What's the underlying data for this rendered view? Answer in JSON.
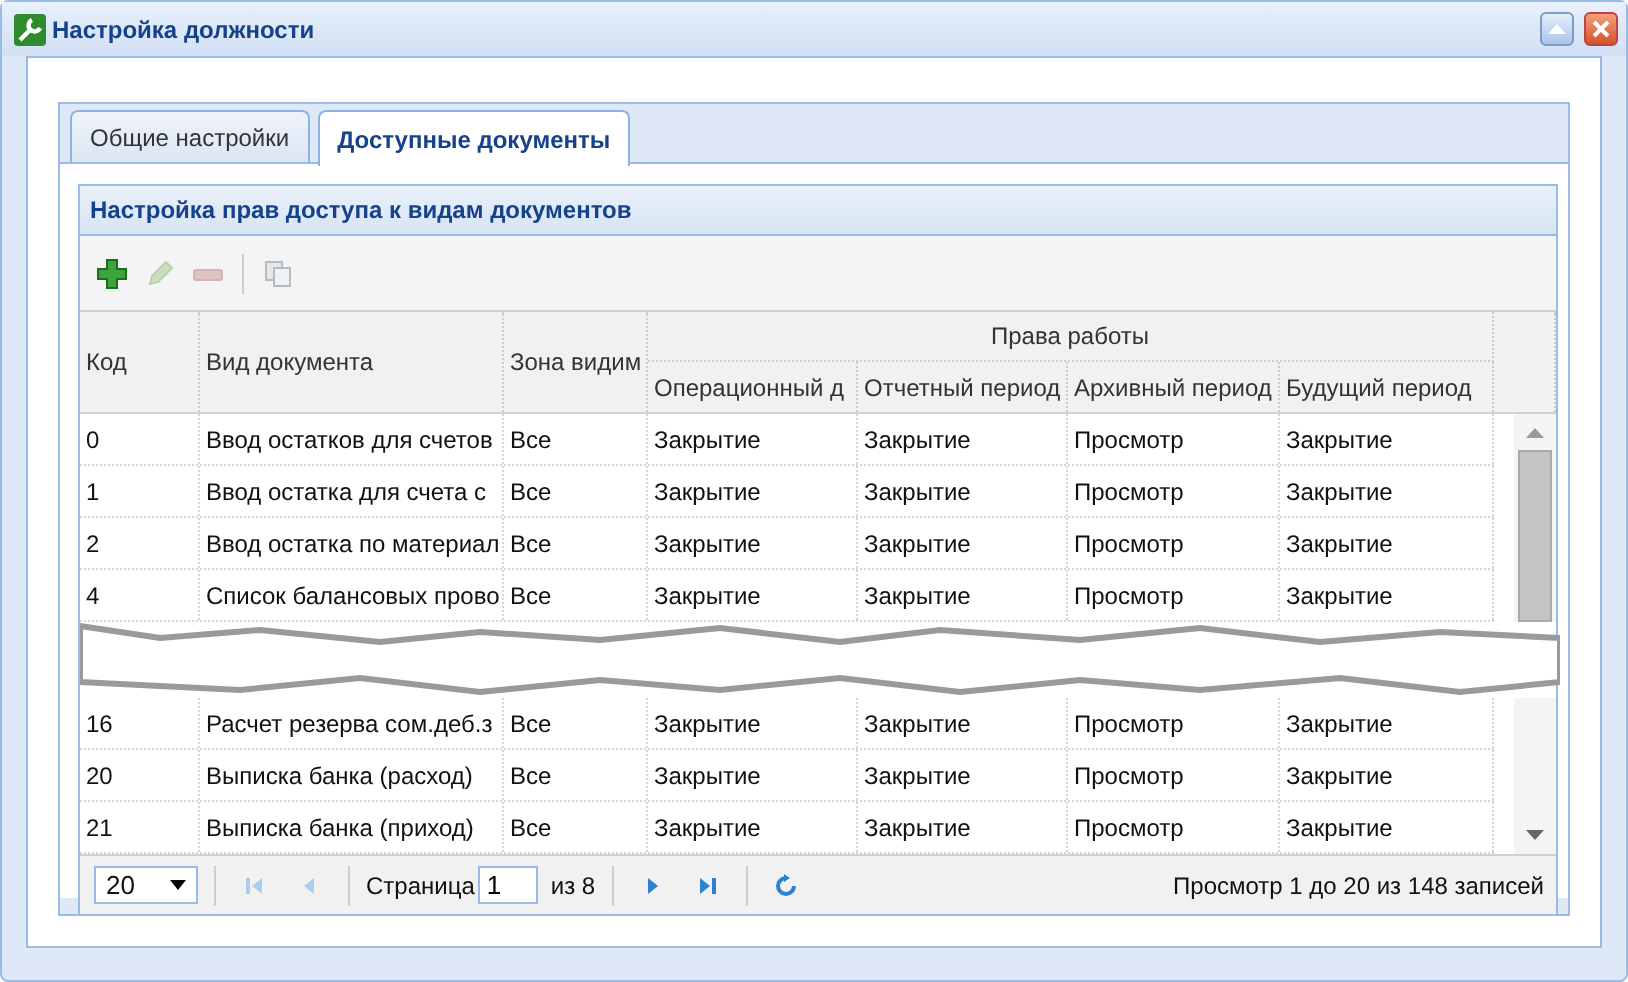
{
  "window": {
    "title": "Настройка должности"
  },
  "tabs": [
    {
      "label": "Общие настройки",
      "selected": false
    },
    {
      "label": "Доступные документы",
      "selected": true
    }
  ],
  "panel": {
    "title": "Настройка прав доступа к видам документов",
    "toolbar": [
      {
        "kind": "add",
        "disabled": false
      },
      {
        "kind": "edit",
        "disabled": true
      },
      {
        "kind": "delete",
        "disabled": true
      },
      {
        "kind": "copy",
        "disabled": true
      }
    ],
    "table": {
      "columns": [
        "Код",
        "Вид документа",
        "Зона видим"
      ],
      "group": {
        "label": "Права работы",
        "columns": [
          "Операционный д",
          "Отчетный период",
          "Архивный период",
          "Будущий период"
        ]
      },
      "row_groups": [
        [
          [
            "0",
            "Ввод остатков для счетов",
            "Все",
            "Закрытие",
            "Закрытие",
            "Просмотр",
            "Закрытие"
          ],
          [
            "1",
            "Ввод остатка для счета с",
            "Все",
            "Закрытие",
            "Закрытие",
            "Просмотр",
            "Закрытие"
          ],
          [
            "2",
            "Ввод остатка по материал",
            "Все",
            "Закрытие",
            "Закрытие",
            "Просмотр",
            "Закрытие"
          ],
          [
            "4",
            "Список балансовых прово",
            "Все",
            "Закрытие",
            "Закрытие",
            "Просмотр",
            "Закрытие"
          ]
        ],
        [
          [
            "16",
            "Расчет резерва сом.деб.з",
            "Все",
            "Закрытие",
            "Закрытие",
            "Просмотр",
            "Закрытие"
          ],
          [
            "20",
            "Выписка банка (расход)",
            "Все",
            "Закрытие",
            "Закрытие",
            "Просмотр",
            "Закрытие"
          ],
          [
            "21",
            "Выписка банка (приход)",
            "Все",
            "Закрытие",
            "Закрытие",
            "Просмотр",
            "Закрытие"
          ]
        ]
      ]
    },
    "pager": {
      "page_size": "20",
      "page_label": "Страница",
      "page": "1",
      "page_count": "из 8",
      "summary": "Просмотр 1 до 20 из 148 записей",
      "buttons": [
        {
          "kind": "first",
          "disabled": true
        },
        {
          "kind": "prev",
          "disabled": true
        },
        {
          "kind": "next",
          "disabled": false
        },
        {
          "kind": "last",
          "disabled": false
        },
        {
          "kind": "refresh",
          "disabled": false
        }
      ]
    }
  }
}
